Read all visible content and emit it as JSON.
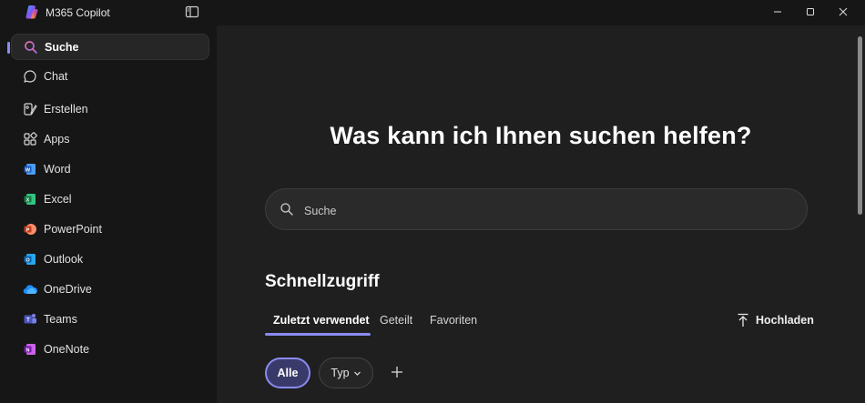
{
  "app": {
    "title": "M365 Copilot"
  },
  "sidebar": {
    "items": [
      {
        "label": "Suche",
        "icon": "search-icon",
        "active": true
      },
      {
        "label": "Chat",
        "icon": "chat-icon"
      },
      {
        "label": "Erstellen",
        "icon": "create-icon"
      },
      {
        "label": "Apps",
        "icon": "apps-icon"
      },
      {
        "label": "Word",
        "icon": "word-icon",
        "color": "#2b7cd3"
      },
      {
        "label": "Excel",
        "icon": "excel-icon",
        "color": "#21a366"
      },
      {
        "label": "PowerPoint",
        "icon": "powerpoint-icon",
        "color": "#d35230"
      },
      {
        "label": "Outlook",
        "icon": "outlook-icon",
        "color": "#1490df"
      },
      {
        "label": "OneDrive",
        "icon": "onedrive-icon",
        "color": "#1a8cff"
      },
      {
        "label": "Teams",
        "icon": "teams-icon",
        "color": "#5b5fc7"
      },
      {
        "label": "OneNote",
        "icon": "onenote-icon",
        "color": "#9b3fc7"
      }
    ]
  },
  "main": {
    "heading": "Was kann ich Ihnen suchen helfen?",
    "search": {
      "placeholder": "Suche"
    },
    "quick_access": {
      "title": "Schnellzugriff",
      "tabs": [
        "Zuletzt verwendet",
        "Geteilt",
        "Favoriten"
      ],
      "active_tab": "Zuletzt verwendet",
      "upload_label": "Hochladen",
      "filters": {
        "all_label": "Alle",
        "type_label": "Typ"
      }
    }
  },
  "colors": {
    "accent": "#8a8cf0",
    "background": "#1f1f1f",
    "sidebar": "#161616"
  }
}
